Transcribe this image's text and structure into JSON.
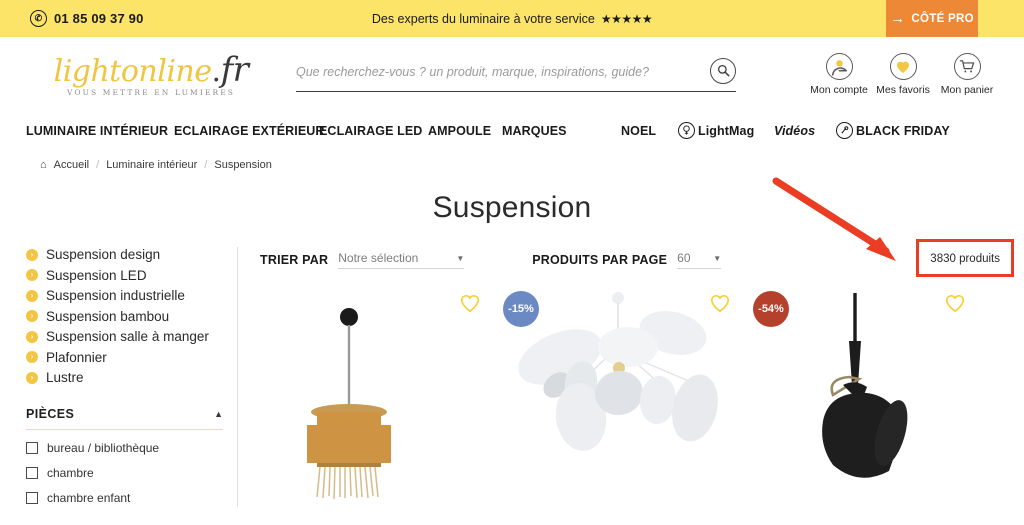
{
  "topbar": {
    "phone": "01 85 09 37 90",
    "phone_icon": "phone-icon",
    "claim": "Des experts du luminaire à votre service",
    "stars": "★★★★★",
    "pro_button": "CÔTÉ PRO",
    "pro_arrow": "→",
    "bg_color": "#fbe468",
    "pro_color": "#ed8936"
  },
  "header": {
    "logo": {
      "name": "lightonline",
      "dot": ".",
      "tld": "fr",
      "tagline": "VOUS METTRE EN LUMIERES",
      "color": "#f0c53f"
    },
    "search": {
      "placeholder": "Que recherchez-vous ? un produit, marque, inspirations, guide?",
      "value": "",
      "icon": "search-icon"
    },
    "account": [
      {
        "icon": "user-icon",
        "label": "Mon compte"
      },
      {
        "icon": "heart-icon",
        "label": "Mes favoris"
      },
      {
        "icon": "cart-icon",
        "label": "Mon panier"
      }
    ]
  },
  "nav": [
    {
      "label": "LUMINAIRE INTÉRIEUR",
      "icon": null,
      "italic": false
    },
    {
      "label": "ECLAIRAGE EXTÉRIEUR",
      "icon": null,
      "italic": false
    },
    {
      "label": "ECLAIRAGE LED",
      "icon": null,
      "italic": false
    },
    {
      "label": "AMPOULE",
      "icon": null,
      "italic": false
    },
    {
      "label": "MARQUES",
      "icon": null,
      "italic": false
    },
    {
      "label": "NOEL",
      "icon": null,
      "italic": false
    },
    {
      "label": "LightMag",
      "icon": "bulb-icon",
      "italic": false
    },
    {
      "label": "Vidéos",
      "icon": null,
      "italic": true
    },
    {
      "label": "BLACK FRIDAY",
      "icon": "tag-icon",
      "italic": false
    }
  ],
  "breadcrumb": {
    "home_icon": "home-icon",
    "items": [
      "Accueil",
      "Luminaire intérieur",
      "Suspension"
    ],
    "separator": "/"
  },
  "page": {
    "title": "Suspension"
  },
  "sidebar": {
    "categories": [
      "Suspension design",
      "Suspension LED",
      "Suspension industrielle",
      "Suspension bambou",
      "Suspension salle à manger",
      "Plafonnier",
      "Lustre"
    ],
    "bullet_icon": "chevron-right-icon",
    "facet": {
      "title": "PIÈCES",
      "collapse_icon": "caret-up-icon",
      "options": [
        "bureau / bibliothèque",
        "chambre",
        "chambre enfant"
      ]
    }
  },
  "toolbar": {
    "sort_label": "TRIER PAR",
    "sort_value": "Notre sélection",
    "perpage_label": "PRODUITS PAR PAGE",
    "perpage_value": "60",
    "caret_icon": "chevron-down-icon",
    "count": "3830 produits"
  },
  "annotation": {
    "arrow_icon": "arrow-pointer",
    "color": "#ea3d23"
  },
  "products": [
    {
      "name": "suspension-ochre-raffia",
      "badge": null,
      "badge_color": null,
      "favorite_icon": "heart-outline-icon"
    },
    {
      "name": "suspension-white-petals",
      "badge": "-15%",
      "badge_color": "#6b8ac4",
      "favorite_icon": "heart-outline-icon"
    },
    {
      "name": "suspension-black-cone",
      "badge": "-54%",
      "badge_color": "#b5402c",
      "favorite_icon": "heart-outline-icon"
    }
  ]
}
